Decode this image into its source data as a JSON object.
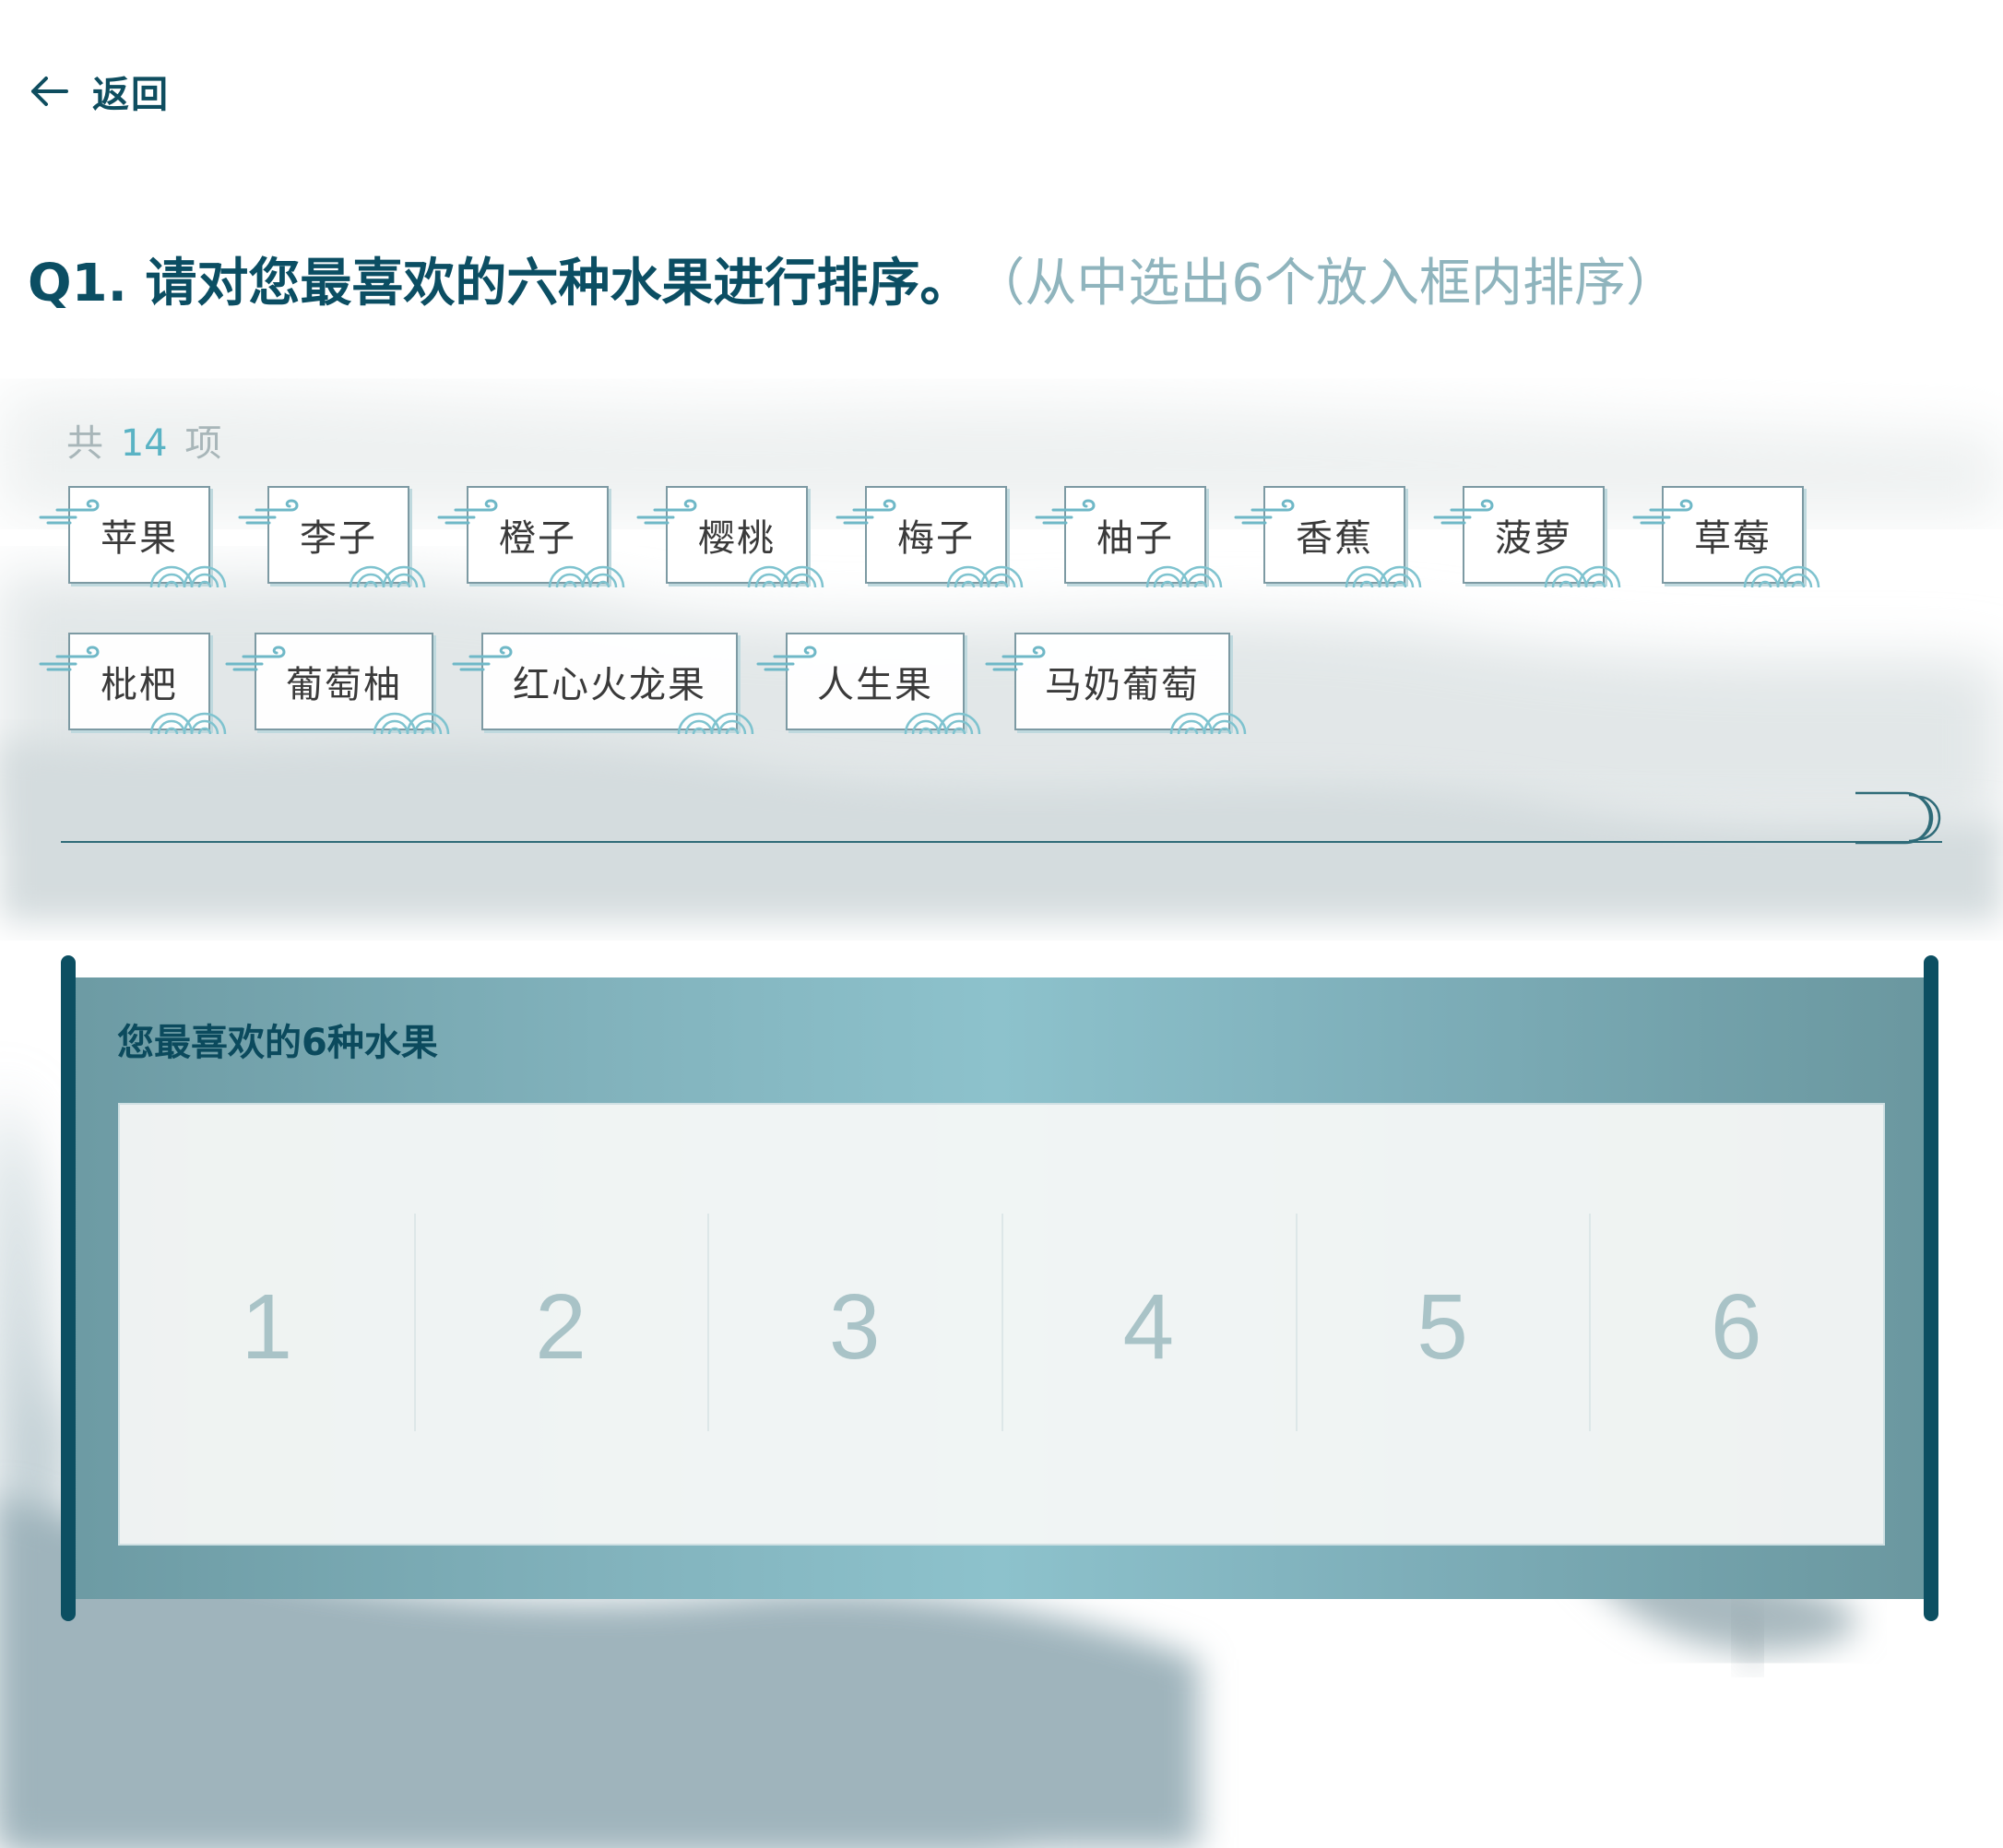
{
  "header": {
    "back_label": "返回",
    "back_icon": "arrow-left-icon"
  },
  "question": {
    "title": "Q1. 请对您最喜欢的六种水果进行排序。",
    "hint": "（从中选出6个放入框内排序）"
  },
  "options": {
    "count_prefix": "共",
    "count_value": "14",
    "count_suffix": "项",
    "items": [
      {
        "label": "苹果"
      },
      {
        "label": "李子"
      },
      {
        "label": "橙子"
      },
      {
        "label": "樱桃"
      },
      {
        "label": "梅子"
      },
      {
        "label": "柚子"
      },
      {
        "label": "香蕉"
      },
      {
        "label": "菠萝"
      },
      {
        "label": "草莓"
      },
      {
        "label": "枇杷"
      },
      {
        "label": "葡萄柚"
      },
      {
        "label": "红心火龙果"
      },
      {
        "label": "人生果"
      },
      {
        "label": "马奶葡萄"
      }
    ]
  },
  "ranking": {
    "title": "您最喜欢的6种水果",
    "slots": [
      "1",
      "2",
      "3",
      "4",
      "5",
      "6"
    ]
  },
  "colors": {
    "primary": "#0b4e63",
    "hint": "#8fb4bd",
    "count_accent": "#5ab3c4",
    "panel": "#82b3bd"
  }
}
